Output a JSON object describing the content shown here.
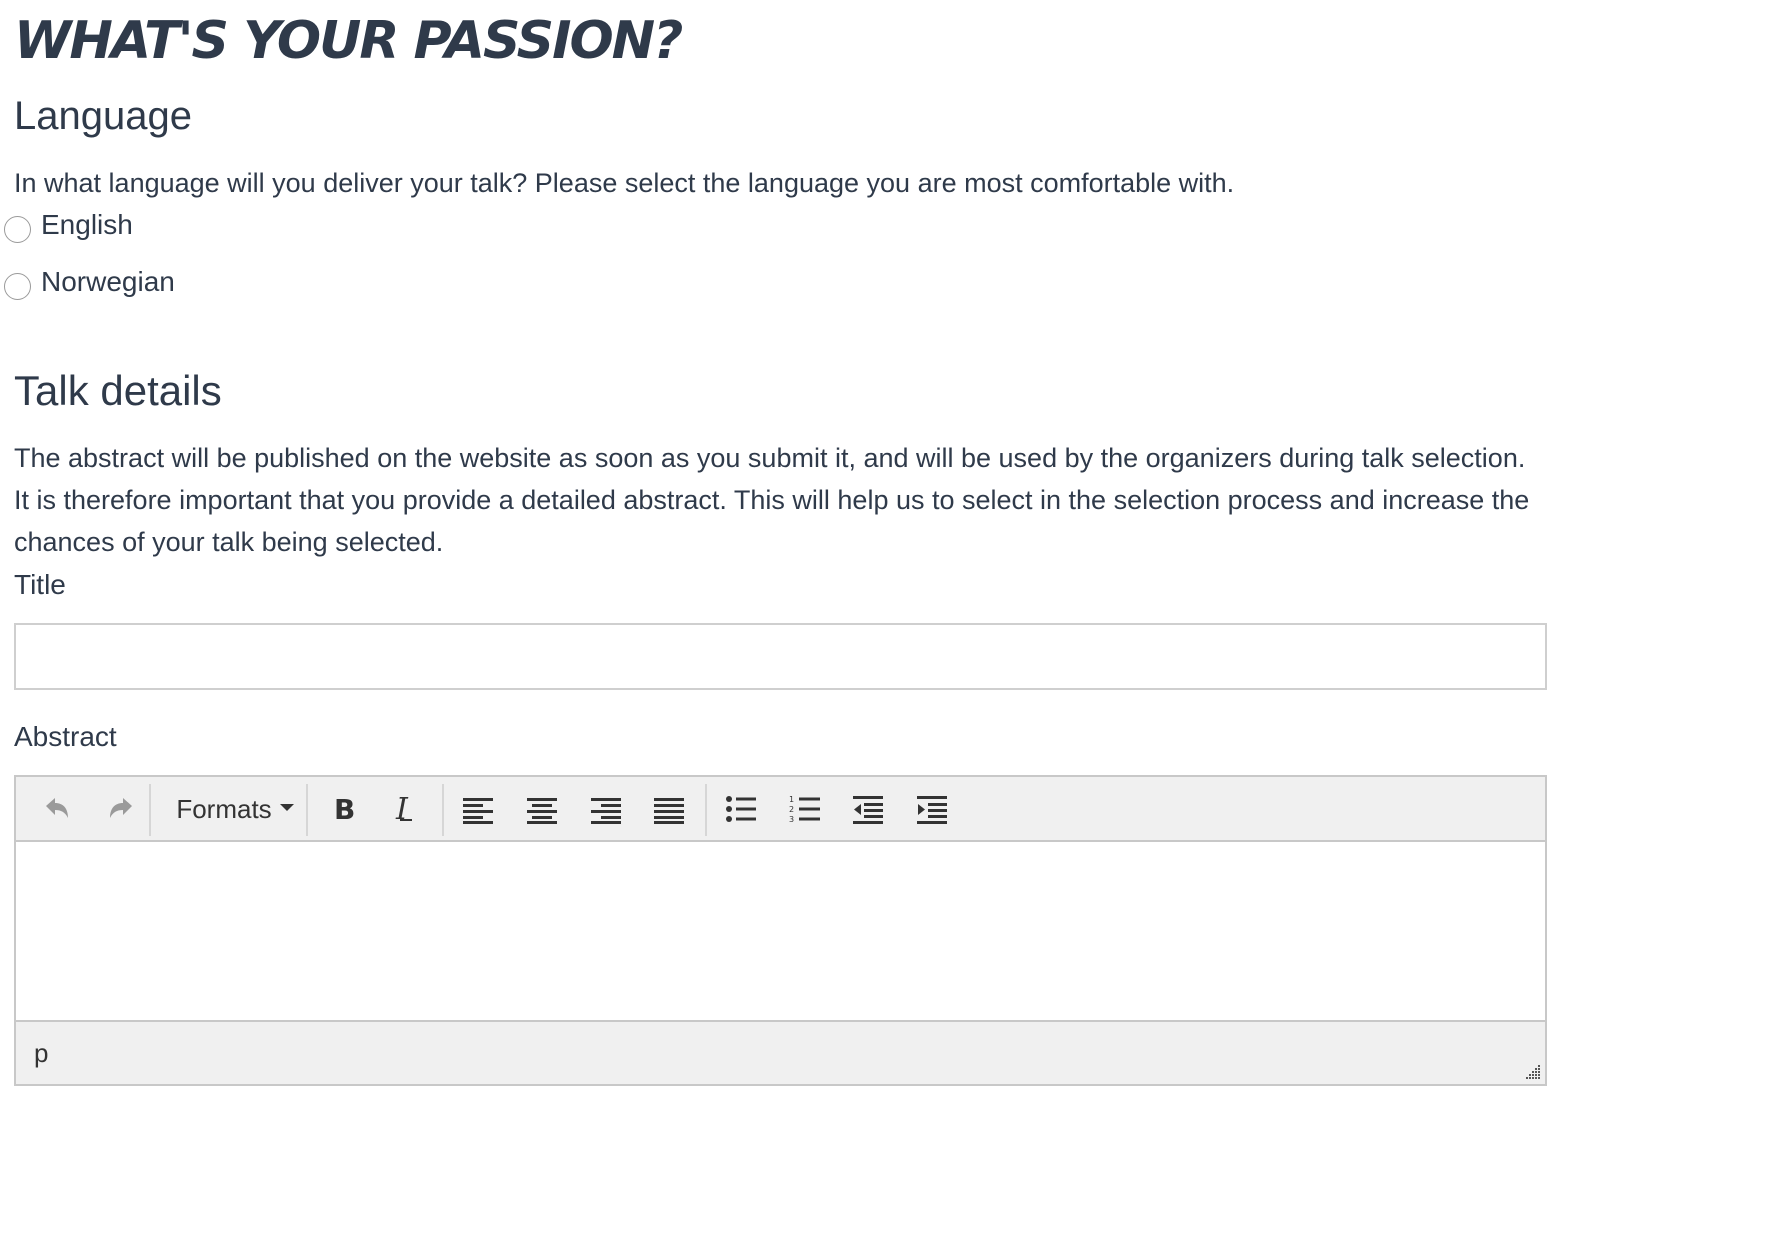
{
  "page": {
    "heading": "WHAT'S YOUR PASSION?"
  },
  "language": {
    "heading": "Language",
    "description": "In what language will you deliver your talk? Please select the language you are most comfortable with.",
    "options": [
      {
        "label": "English",
        "selected": false
      },
      {
        "label": "Norwegian",
        "selected": false
      }
    ]
  },
  "talk_details": {
    "heading": "Talk details",
    "description": "The abstract will be published on the website as soon as you submit it, and will be used by the organizers during talk selection. It is therefore important that you provide a detailed abstract. This will help us to select in the selection process and increase the chances of your talk being selected.",
    "title_label": "Title",
    "title_value": "",
    "abstract_label": "Abstract"
  },
  "editor": {
    "toolbar": {
      "undo_icon": "undo-icon",
      "redo_icon": "redo-icon",
      "formats_label": "Formats",
      "bold_icon": "bold-icon",
      "italic_icon": "italic-icon",
      "align_left_icon": "align-left-icon",
      "align_center_icon": "align-center-icon",
      "align_right_icon": "align-right-icon",
      "align_justify_icon": "align-justify-icon",
      "bullet_list_icon": "bullet-list-icon",
      "numbered_list_icon": "numbered-list-icon",
      "outdent_icon": "outdent-icon",
      "indent_icon": "indent-icon"
    },
    "content": "",
    "status_path": "p"
  },
  "colors": {
    "text": "#2f3a4a",
    "toolbar_bg": "#f0f0f0",
    "border": "#c8c8c8",
    "icon_disabled": "#9a9a9a",
    "icon": "#333333"
  }
}
